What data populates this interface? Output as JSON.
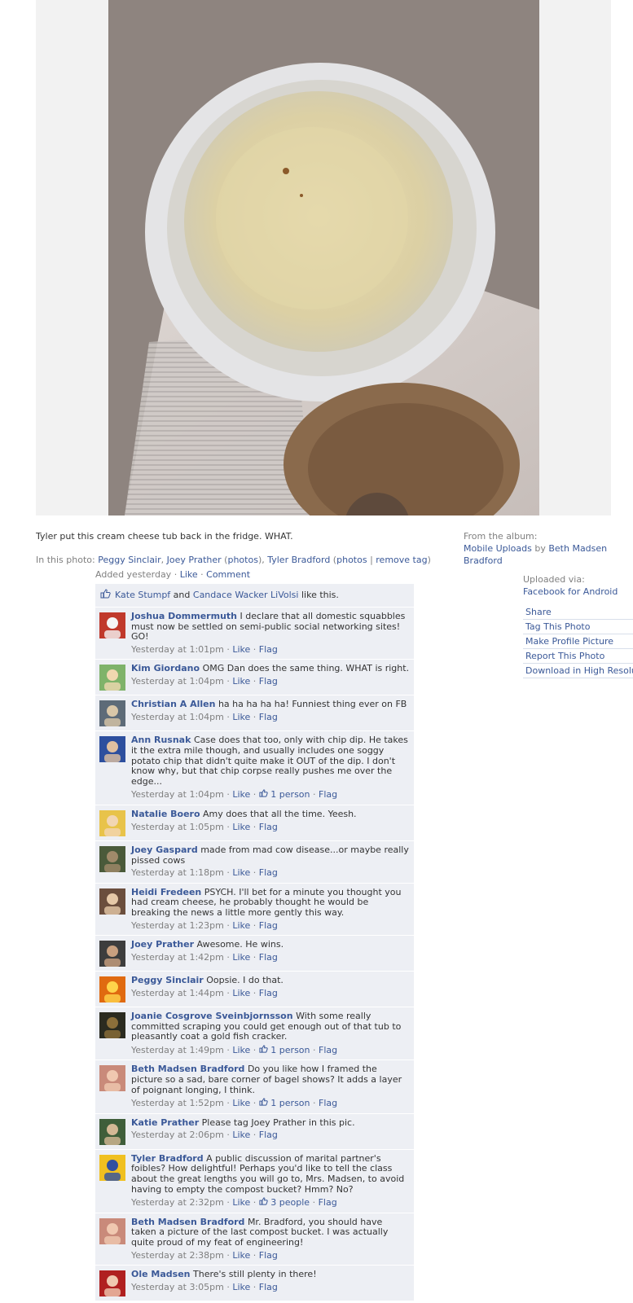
{
  "caption": "Tyler put this cream cheese tub back in the fridge. WHAT.",
  "in_photo": {
    "label": "In this photo:",
    "people": [
      {
        "name": "Peggy Sinclair",
        "sep": ", "
      },
      {
        "name": "Joey Prather",
        "extra_open": " (",
        "extra": "photos",
        "extra_close": "), "
      },
      {
        "name": "Tyler Bradford",
        "extra_open": " (",
        "extra": "photos",
        "pipe": " | ",
        "extra2": "remove tag",
        "extra_close": ")"
      }
    ]
  },
  "added": {
    "text": "Added yesterday",
    "like": "Like",
    "comment": "Comment",
    "sep": " · "
  },
  "album": {
    "from_label": "From the album:",
    "album_name": "Mobile Uploads",
    "by": " by ",
    "owner": "Beth Madsen Bradford"
  },
  "uploaded": {
    "label": "Uploaded via:",
    "app": "Facebook for Android"
  },
  "actions": [
    "Share",
    "Tag This Photo",
    "Make Profile Picture",
    "Report This Photo",
    "Download in High Resolution"
  ],
  "likes": {
    "person1": "Kate Stumpf",
    "and": " and ",
    "person2": "Candace Wacker LiVolsi",
    "suffix": " like this."
  },
  "comment_labels": {
    "like": "Like",
    "flag": "Flag",
    "sep": " · "
  },
  "comments": [
    {
      "author": "Joshua Dommermuth",
      "text": "I declare that all domestic squabbles must now be settled on semi-public social networking sites! GO!",
      "time": "Yesterday at 1:01pm",
      "likes": ""
    },
    {
      "author": "Kim Giordano",
      "text": "OMG Dan does the same thing. WHAT is right.",
      "time": "Yesterday at 1:04pm",
      "likes": ""
    },
    {
      "author": "Christian A Allen",
      "text": "ha ha ha ha ha! Funniest thing ever on FB",
      "time": "Yesterday at 1:04pm",
      "likes": ""
    },
    {
      "author": "Ann Rusnak",
      "text": "Case does that too, only with chip dip. He takes it the extra mile though, and usually includes one soggy potato chip that didn't quite make it OUT of the dip. I don't know why, but that chip corpse really pushes me over the edge...",
      "time": "Yesterday at 1:04pm",
      "likes": "1 person"
    },
    {
      "author": "Natalie Boero",
      "text": "Amy does that all the time. Yeesh.",
      "time": "Yesterday at 1:05pm",
      "likes": ""
    },
    {
      "author": "Joey Gaspard",
      "text": "made from mad cow disease...or maybe really pissed cows",
      "time": "Yesterday at 1:18pm",
      "likes": ""
    },
    {
      "author": "Heidi Fredeen",
      "text": "PSYCH. I'll bet for a minute you thought you had cream cheese, he probably thought he would be breaking the news a little more gently this way.",
      "time": "Yesterday at 1:23pm",
      "likes": ""
    },
    {
      "author": "Joey Prather",
      "text": "Awesome. He wins.",
      "time": "Yesterday at 1:42pm",
      "likes": ""
    },
    {
      "author": "Peggy Sinclair",
      "text": "Oopsie. I do that.",
      "time": "Yesterday at 1:44pm",
      "likes": ""
    },
    {
      "author": "Joanie Cosgrove Sveinbjornsson",
      "text": "With some really committed scraping you could get enough out of that tub to pleasantly coat a gold fish cracker.",
      "time": "Yesterday at 1:49pm",
      "likes": "1 person"
    },
    {
      "author": "Beth Madsen Bradford",
      "text": "Do you like how I framed the picture so a sad, bare corner of bagel shows? It adds a layer of poignant longing, I think.",
      "time": "Yesterday at 1:52pm",
      "likes": "1 person"
    },
    {
      "author": "Katie Prather",
      "text": "Please tag Joey Prather in this pic.",
      "time": "Yesterday at 2:06pm",
      "likes": ""
    },
    {
      "author": "Tyler Bradford",
      "text": "A public discussion of marital partner's foibles? How delightful! Perhaps you'd like to tell the class about the great lengths you will go to, Mrs. Madsen, to avoid having to empty the compost bucket? Hmm? No?",
      "time": "Yesterday at 2:32pm",
      "likes": "3 people"
    },
    {
      "author": "Beth Madsen Bradford",
      "text": "Mr. Bradford, you should have taken a picture of the last compost bucket. I was actually quite proud of my feat of engineering!",
      "time": "Yesterday at 2:38pm",
      "likes": ""
    },
    {
      "author": "Ole Madsen",
      "text": "There's still plenty in there!",
      "time": "Yesterday at 3:05pm",
      "likes": ""
    }
  ],
  "colors": {
    "link": "#3b5998",
    "comment_bg": "#edeff4",
    "meta_grey": "#808080",
    "stage_bg": "#f2f2f2"
  },
  "icons": [
    "thumbs-up-icon"
  ]
}
